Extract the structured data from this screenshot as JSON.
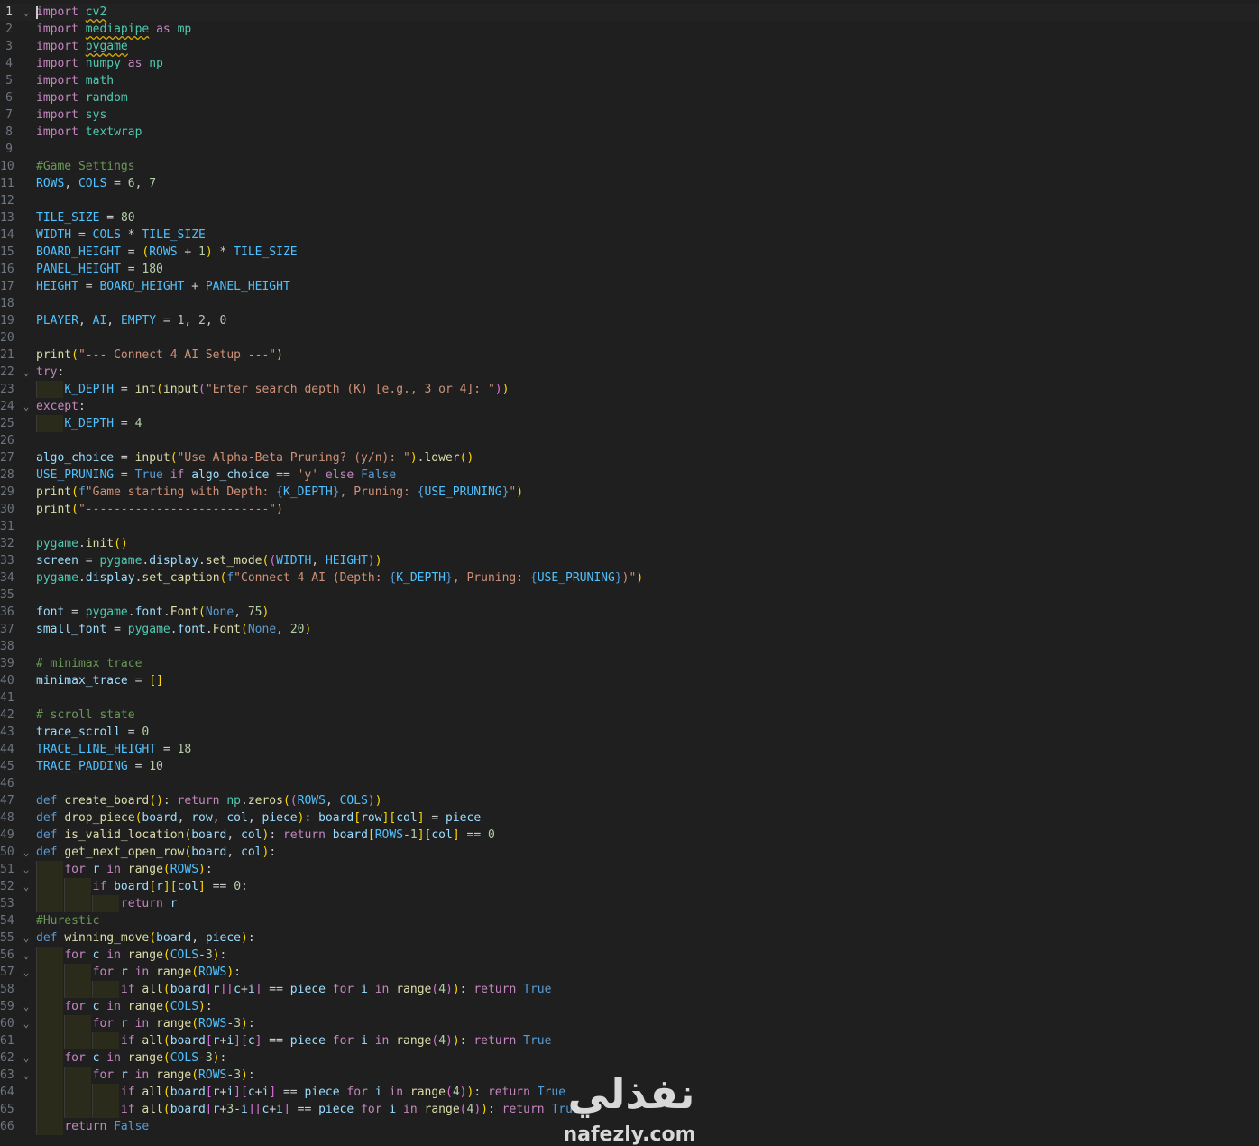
{
  "editor": {
    "language": "python",
    "colors": {
      "background": "#1f1f1f",
      "keyword": "#569cd6",
      "control": "#c586c0",
      "function": "#dcdcaa",
      "string": "#ce9178",
      "number": "#b5cea8",
      "comment": "#6a9955",
      "constant": "#4fc1ff"
    },
    "lines": [
      {
        "n": "1",
        "text": "import cv2",
        "fold": true
      },
      {
        "n": "2",
        "text": "import mediapipe as mp"
      },
      {
        "n": "3",
        "text": "import pygame"
      },
      {
        "n": "4",
        "text": "import numpy as np"
      },
      {
        "n": "5",
        "text": "import math"
      },
      {
        "n": "6",
        "text": "import random"
      },
      {
        "n": "7",
        "text": "import sys"
      },
      {
        "n": "8",
        "text": "import textwrap"
      },
      {
        "n": "9",
        "text": ""
      },
      {
        "n": "10",
        "text": "#Game Settings"
      },
      {
        "n": "11",
        "text": "ROWS, COLS = 6, 7"
      },
      {
        "n": "12",
        "text": ""
      },
      {
        "n": "13",
        "text": "TILE_SIZE = 80"
      },
      {
        "n": "14",
        "text": "WIDTH = COLS * TILE_SIZE"
      },
      {
        "n": "15",
        "text": "BOARD_HEIGHT = (ROWS + 1) * TILE_SIZE"
      },
      {
        "n": "16",
        "text": "PANEL_HEIGHT = 180"
      },
      {
        "n": "17",
        "text": "HEIGHT = BOARD_HEIGHT + PANEL_HEIGHT"
      },
      {
        "n": "18",
        "text": ""
      },
      {
        "n": "19",
        "text": "PLAYER, AI, EMPTY = 1, 2, 0"
      },
      {
        "n": "20",
        "text": ""
      },
      {
        "n": "21",
        "text": "print(\"--- Connect 4 AI Setup ---\")"
      },
      {
        "n": "22",
        "text": "try:",
        "fold": true
      },
      {
        "n": "23",
        "text": "    K_DEPTH = int(input(\"Enter search depth (K) [e.g., 3 or 4]: \"))"
      },
      {
        "n": "24",
        "text": "except:",
        "fold": true
      },
      {
        "n": "25",
        "text": "    K_DEPTH = 4"
      },
      {
        "n": "26",
        "text": ""
      },
      {
        "n": "27",
        "text": "algo_choice = input(\"Use Alpha-Beta Pruning? (y/n): \").lower()"
      },
      {
        "n": "28",
        "text": "USE_PRUNING = True if algo_choice == 'y' else False"
      },
      {
        "n": "29",
        "text": "print(f\"Game starting with Depth: {K_DEPTH}, Pruning: {USE_PRUNING}\")"
      },
      {
        "n": "30",
        "text": "print(\"--------------------------\")"
      },
      {
        "n": "31",
        "text": ""
      },
      {
        "n": "32",
        "text": "pygame.init()"
      },
      {
        "n": "33",
        "text": "screen = pygame.display.set_mode((WIDTH, HEIGHT))"
      },
      {
        "n": "34",
        "text": "pygame.display.set_caption(f\"Connect 4 AI (Depth: {K_DEPTH}, Pruning: {USE_PRUNING})\")"
      },
      {
        "n": "35",
        "text": ""
      },
      {
        "n": "36",
        "text": "font = pygame.font.Font(None, 75)"
      },
      {
        "n": "37",
        "text": "small_font = pygame.font.Font(None, 20)"
      },
      {
        "n": "38",
        "text": ""
      },
      {
        "n": "39",
        "text": "# minimax trace"
      },
      {
        "n": "40",
        "text": "minimax_trace = []"
      },
      {
        "n": "41",
        "text": ""
      },
      {
        "n": "42",
        "text": "# scroll state"
      },
      {
        "n": "43",
        "text": "trace_scroll = 0"
      },
      {
        "n": "44",
        "text": "TRACE_LINE_HEIGHT = 18"
      },
      {
        "n": "45",
        "text": "TRACE_PADDING = 10"
      },
      {
        "n": "46",
        "text": ""
      },
      {
        "n": "47",
        "text": "def create_board(): return np.zeros((ROWS, COLS))"
      },
      {
        "n": "48",
        "text": "def drop_piece(board, row, col, piece): board[row][col] = piece"
      },
      {
        "n": "49",
        "text": "def is_valid_location(board, col): return board[ROWS-1][col] == 0"
      },
      {
        "n": "50",
        "text": "def get_next_open_row(board, col):",
        "fold": true
      },
      {
        "n": "51",
        "text": "    for r in range(ROWS):",
        "fold": true
      },
      {
        "n": "52",
        "text": "        if board[r][col] == 0:",
        "fold": true
      },
      {
        "n": "53",
        "text": "            return r"
      },
      {
        "n": "54",
        "text": "#Hurestic"
      },
      {
        "n": "55",
        "text": "def winning_move(board, piece):",
        "fold": true
      },
      {
        "n": "56",
        "text": "    for c in range(COLS-3):",
        "fold": true
      },
      {
        "n": "57",
        "text": "        for r in range(ROWS):",
        "fold": true
      },
      {
        "n": "58",
        "text": "            if all(board[r][c+i] == piece for i in range(4)): return True"
      },
      {
        "n": "59",
        "text": "    for c in range(COLS):",
        "fold": true
      },
      {
        "n": "60",
        "text": "        for r in range(ROWS-3):",
        "fold": true
      },
      {
        "n": "61",
        "text": "            if all(board[r+i][c] == piece for i in range(4)): return True"
      },
      {
        "n": "62",
        "text": "    for c in range(COLS-3):",
        "fold": true
      },
      {
        "n": "63",
        "text": "        for r in range(ROWS-3):",
        "fold": true
      },
      {
        "n": "64",
        "text": "            if all(board[r+i][c+i] == piece for i in range(4)): return True"
      },
      {
        "n": "65",
        "text": "            if all(board[r+3-i][c+i] == piece for i in range(4)): return True"
      },
      {
        "n": "66",
        "text": "    return False"
      }
    ]
  },
  "watermark": {
    "arabic": "نفذلي",
    "domain": "nafezly.com"
  }
}
